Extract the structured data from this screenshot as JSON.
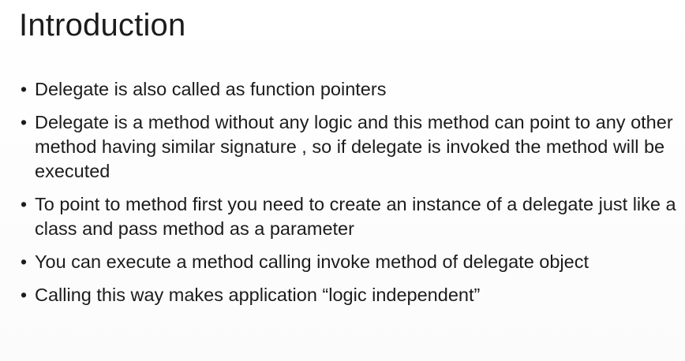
{
  "slide": {
    "title": "Introduction",
    "bullet_symbol": "•",
    "bullets": [
      {
        "text": "Delegate is also called as function pointers"
      },
      {
        "text": "Delegate is a method without any logic  and this method can point to any other method having  similar signature , so if delegate is invoked the method will be executed"
      },
      {
        "text": "To point to method first you need to create an instance of a delegate just like a class and pass method as a parameter"
      },
      {
        "text": "You can execute a method calling invoke method of delegate object"
      },
      {
        "text": "Calling this way makes application “logic independent”"
      }
    ]
  }
}
